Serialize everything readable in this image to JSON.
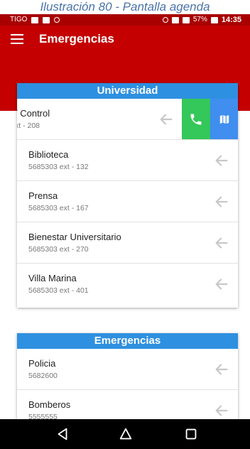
{
  "caption": "Ilustración 80 - Pantalla agenda",
  "status_bar": {
    "carrier": "TIGO",
    "battery": "57%",
    "time": "14:35"
  },
  "app_bar": {
    "title": "Emergencias",
    "menu_icon": "hamburger-menu-icon"
  },
  "sections": [
    {
      "header": "Universidad",
      "items": [
        {
          "name": "/ Control",
          "ext": "xt - 208"
        },
        {
          "name": "Biblioteca",
          "ext": "5685303 ext - 132"
        },
        {
          "name": "Prensa",
          "ext": "5685303 ext - 167"
        },
        {
          "name": "Bienestar Universitario",
          "ext": "5685303 ext - 270"
        },
        {
          "name": "Villa Marina",
          "ext": "5685303 ext - 401"
        }
      ]
    },
    {
      "header": "Emergencias",
      "items": [
        {
          "name": "Policia",
          "ext": "5682600"
        },
        {
          "name": "Bomberos",
          "ext": "5555555"
        }
      ]
    }
  ],
  "colors": {
    "app_bar": "#c40000",
    "section_header": "#2e90e0",
    "call_action": "#34c759",
    "map_action": "#3f8ef0"
  },
  "icons": {
    "row_arrow": "arrow-left-icon",
    "call_action": "phone-icon",
    "map_action": "map-icon",
    "nav_back": "back-triangle-icon",
    "nav_home": "home-circle-icon",
    "nav_recent": "recents-square-icon"
  }
}
